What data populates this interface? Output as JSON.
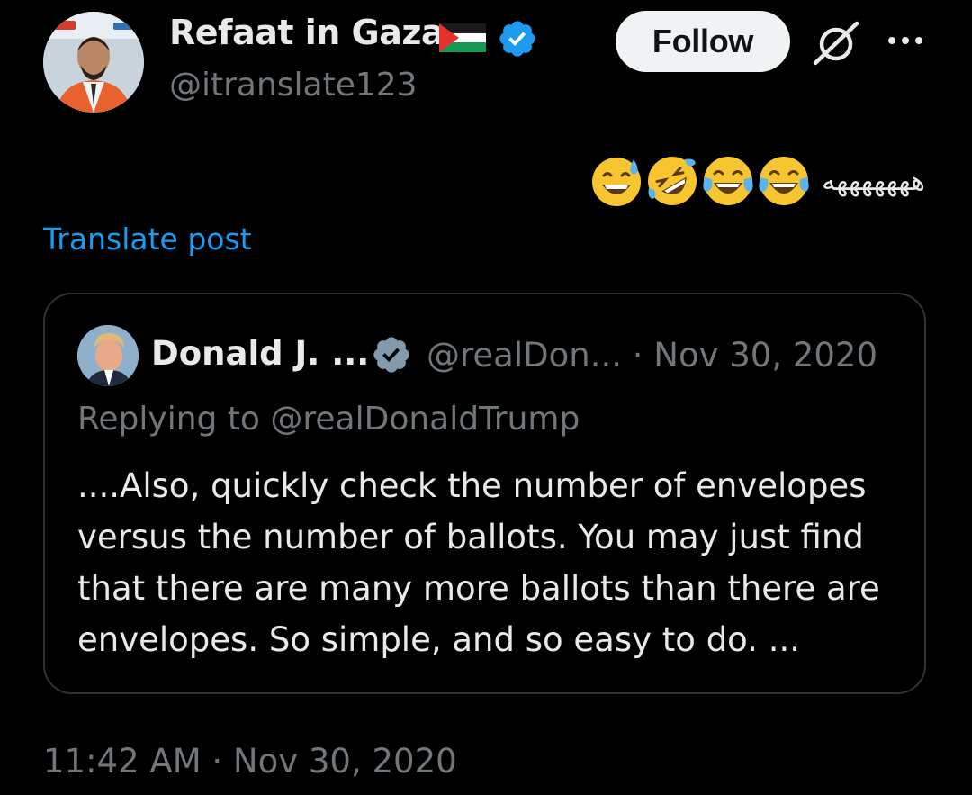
{
  "post": {
    "author": {
      "name": "Refaat in Gaza",
      "handle": "@itranslate123",
      "flag": "palestine-flag",
      "verified": true
    },
    "follow_label": "Follow",
    "text_arabic": "هههههههه",
    "emojis": [
      "grinning-sweat-emoji",
      "rolling-laughing-emoji",
      "tears-of-joy-emoji",
      "tears-of-joy-emoji"
    ],
    "translate_label": "Translate post",
    "timestamp": "11:42 AM · Nov 30, 2020"
  },
  "quote": {
    "name": "Donald J. ...",
    "handle_date": "@realDon... · Nov 30, 2020",
    "replying": "Replying to @realDonaldTrump",
    "body": "....Also, quickly check the number of envelopes versus the number of ballots. You may just find that there are many more ballots than there are envelopes. So simple, and so easy to do. ..."
  },
  "colors": {
    "background": "#000000",
    "text_primary": "#e7e9ea",
    "text_secondary": "#71767b",
    "link": "#1d9bf0",
    "verified": "#1d9bf0",
    "border": "#2f3336"
  }
}
